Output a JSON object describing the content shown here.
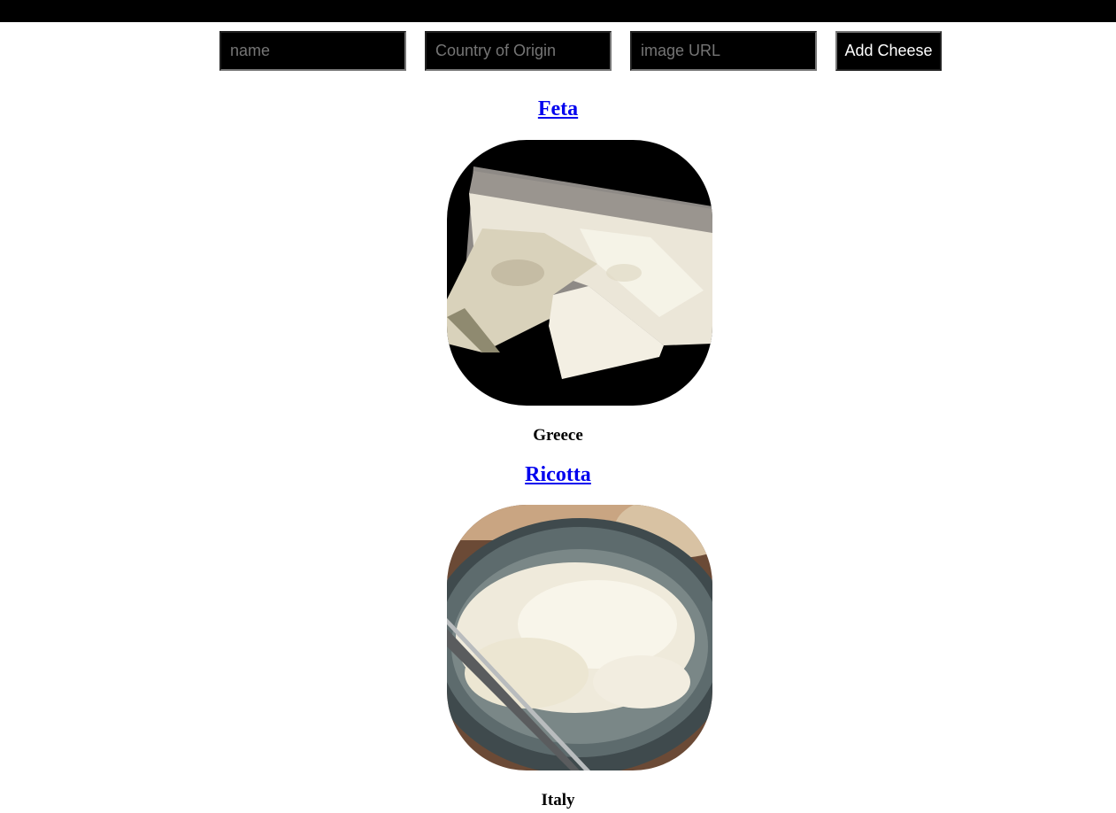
{
  "form": {
    "name_placeholder": "name",
    "country_placeholder": "Country of Origin",
    "image_placeholder": "image URL",
    "submit_label": "Add Cheese"
  },
  "cheeses": [
    {
      "name": "Feta",
      "country": "Greece"
    },
    {
      "name": "Ricotta",
      "country": "Italy"
    }
  ],
  "colors": {
    "bar": "#000000",
    "link": "#0000ee",
    "input_bg": "#000000"
  }
}
